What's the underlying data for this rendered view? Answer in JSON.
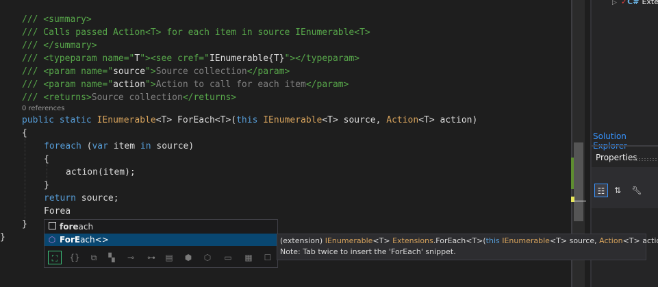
{
  "editor": {
    "lines": {
      "l1": "/// <summary>",
      "l2_a": "/// Calls passed Action<T> for each item in source IEnumerable<T>",
      "l3": "/// </summary>",
      "l4_a": "/// ",
      "l4_b": "<typeparam name=\"",
      "l4_c": "T",
      "l4_d": "\"><see cref=\"",
      "l4_e": "IEnumerable{T}",
      "l4_f": "\"></typeparam>",
      "l5_a": "/// ",
      "l5_b": "<param name=\"",
      "l5_c": "source",
      "l5_d": "\">",
      "l5_e": "Source collection",
      "l5_f": "</param>",
      "l6_a": "/// ",
      "l6_b": "<param name=\"",
      "l6_c": "action",
      "l6_d": "\">",
      "l6_e": "Action to call for each item",
      "l6_f": "</param>",
      "l7_a": "/// ",
      "l7_b": "<returns>",
      "l7_c": "Source collection",
      "l7_d": "</returns>",
      "codelens": "0 references",
      "sig_public": "public",
      "sig_static": "static",
      "sig_ienum": "IEnumerable",
      "sig_t1": "<T> ",
      "sig_name": "ForEach<T>(",
      "sig_this": "this",
      "sig_ienum2": "IEnumerable",
      "sig_src": "<T> source, ",
      "sig_action": "Action",
      "sig_act2": "<T> action)",
      "brace_open": "{",
      "fe_kw": "foreach",
      "fe_open": " (",
      "fe_var": "var",
      "fe_item": " item ",
      "fe_in": "in",
      "fe_src": " source)",
      "brace2_open": "{",
      "call": "action(item);",
      "brace2_close": "}",
      "ret_kw": "return",
      "ret_rest": " source;",
      "typed": "Forea",
      "brace_close": "}",
      "outer_close": "}"
    }
  },
  "completion": {
    "items": [
      {
        "prefix": "fore",
        "rest": "ach",
        "icon": "snippet-icon"
      },
      {
        "prefix": "ForE",
        "rest": "ach<>",
        "icon": "extension-method-icon"
      }
    ],
    "footer_icons": [
      "expand-filter-icon",
      "braces-icon",
      "class-icon",
      "struct-icon",
      "interface-icon",
      "delegate-icon",
      "enum-icon",
      "module-icon",
      "method-filter-icon",
      "keyword-icon",
      "snippet-filter-icon"
    ]
  },
  "tooltip": {
    "l1_a": "(extension) ",
    "l1_b": "IEnumerable",
    "l1_c": "<T> ",
    "l1_d": "Extensions",
    "l1_e": ".ForEach<T>(",
    "l1_f": "this",
    "l1_g": " ",
    "l1_h": "IEnumerable",
    "l1_i": "<T> source, ",
    "l1_j": "Action",
    "l1_k": "<T> action)",
    "l2": "Note: Tab twice to insert the 'ForEach' snippet."
  },
  "panel": {
    "tree_item": "Exten",
    "solution_explorer": "Solution Explorer",
    "properties": "Properties"
  },
  "colors": {
    "comment": "#57a64a",
    "keyword": "#569cd6",
    "type": "#d69d85",
    "selection": "#094771"
  }
}
